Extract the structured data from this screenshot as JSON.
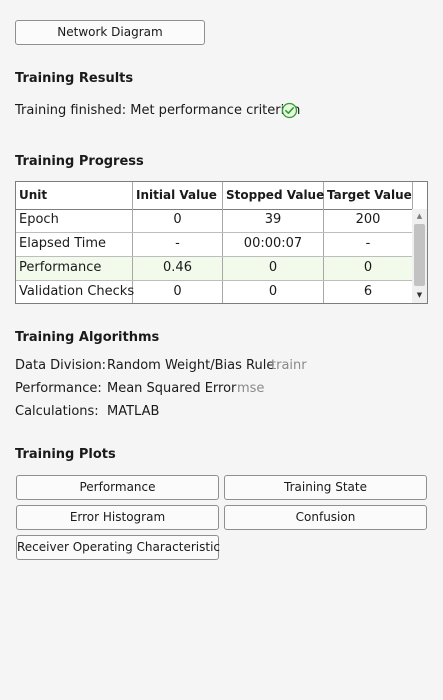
{
  "top": {
    "network_diagram_label": "Network Diagram"
  },
  "results": {
    "title": "Training Results",
    "status_text": "Training finished: Met performance criterion",
    "status_icon": "success-check-icon",
    "status_color": "#2e9e2e"
  },
  "progress": {
    "title": "Training Progress",
    "columns": [
      "Unit",
      "Initial Value",
      "Stopped Value",
      "Target Value"
    ],
    "rows": [
      {
        "unit": "Epoch",
        "initial": "0",
        "stopped": "39",
        "target": "200"
      },
      {
        "unit": "Elapsed Time",
        "initial": "-",
        "stopped": "00:00:07",
        "target": "-"
      },
      {
        "unit": "Performance",
        "initial": "0.46",
        "stopped": "0",
        "target": "0"
      },
      {
        "unit": "Validation Checks",
        "initial": "0",
        "stopped": "0",
        "target": "6"
      }
    ],
    "highlight_color": "#f1faeb"
  },
  "algorithms": {
    "title": "Training Algorithms",
    "items": [
      {
        "label": "Data Division:",
        "value": "Random Weight/Bias Rule",
        "fn": "trainr"
      },
      {
        "label": "Performance:",
        "value": "Mean Squared Error",
        "fn": "mse"
      },
      {
        "label": "Calculations:",
        "value": "MATLAB",
        "fn": ""
      }
    ]
  },
  "plots": {
    "title": "Training Plots",
    "buttons": [
      "Performance",
      "Training State",
      "Error Histogram",
      "Confusion",
      "Receiver Operating Characteristic"
    ]
  }
}
